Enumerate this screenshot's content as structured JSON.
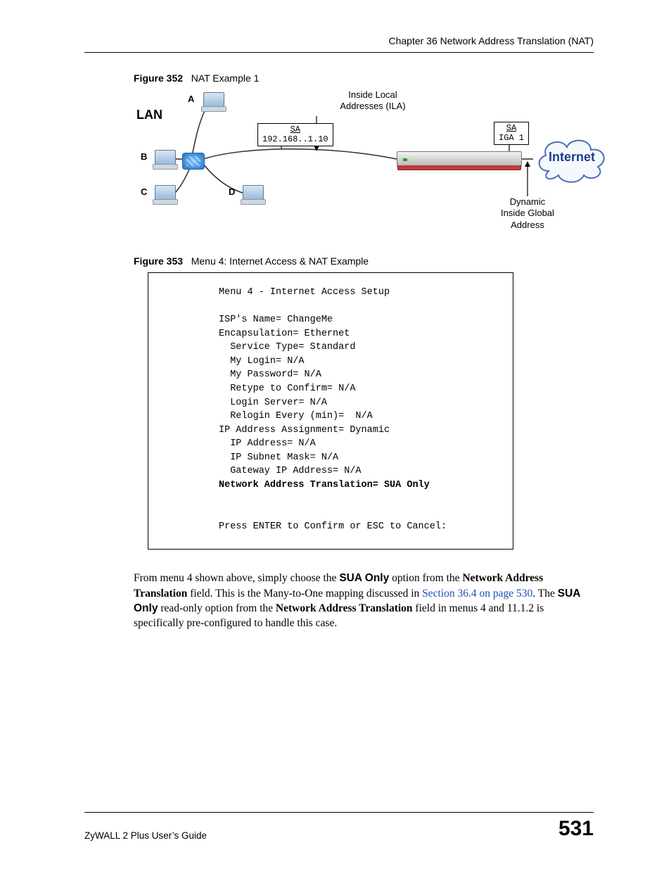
{
  "header": {
    "chapter": "Chapter 36 Network Address Translation (NAT)"
  },
  "fig352": {
    "num": "Figure 352",
    "title": "NAT Example 1",
    "labels": {
      "lan": "LAN",
      "a": "A",
      "b": "B",
      "c": "C",
      "d": "D",
      "ila_line1": "Inside Local",
      "ila_line2": "Addresses (ILA)",
      "sa1_label": "SA",
      "sa1_ip": "192.168..1.10",
      "sa2_label": "SA",
      "sa2_iga": "IGA 1",
      "internet": "Internet",
      "dyn_line1": "Dynamic",
      "dyn_line2": "Inside Global",
      "dyn_line3": "Address"
    }
  },
  "fig353": {
    "num": "Figure 353",
    "title": "Menu 4: Internet Access & NAT Example",
    "menu": {
      "title": "Menu 4 - Internet Access Setup",
      "lines": [
        "ISP's Name= ChangeMe",
        "Encapsulation= Ethernet",
        "  Service Type= Standard",
        "  My Login= N/A",
        "  My Password= N/A",
        "  Retype to Confirm= N/A",
        "  Login Server= N/A",
        "  Relogin Every (min)=  N/A",
        "IP Address Assignment= Dynamic",
        "  IP Address= N/A",
        "  IP Subnet Mask= N/A",
        "  Gateway IP Address= N/A"
      ],
      "bold_line": "Network Address Translation= SUA Only",
      "prompt": "Press ENTER to Confirm or ESC to Cancel:"
    }
  },
  "para": {
    "t1": "From menu 4 shown above, simply choose the ",
    "b1": "SUA Only",
    "t2": " option from the ",
    "b2": "Network Address Translation",
    "t3": " field. This is the Many-to-One mapping discussed in ",
    "xref": "Section 36.4 on page 530",
    "t4": ". The ",
    "b3": "SUA Only",
    "t5": " read-only option from the ",
    "b4": "Network Address Translation",
    "t6": " field in menus 4 and 11.1.2 is specifically pre-configured to handle this case."
  },
  "footer": {
    "guide": "ZyWALL 2 Plus User’s Guide",
    "page": "531"
  }
}
